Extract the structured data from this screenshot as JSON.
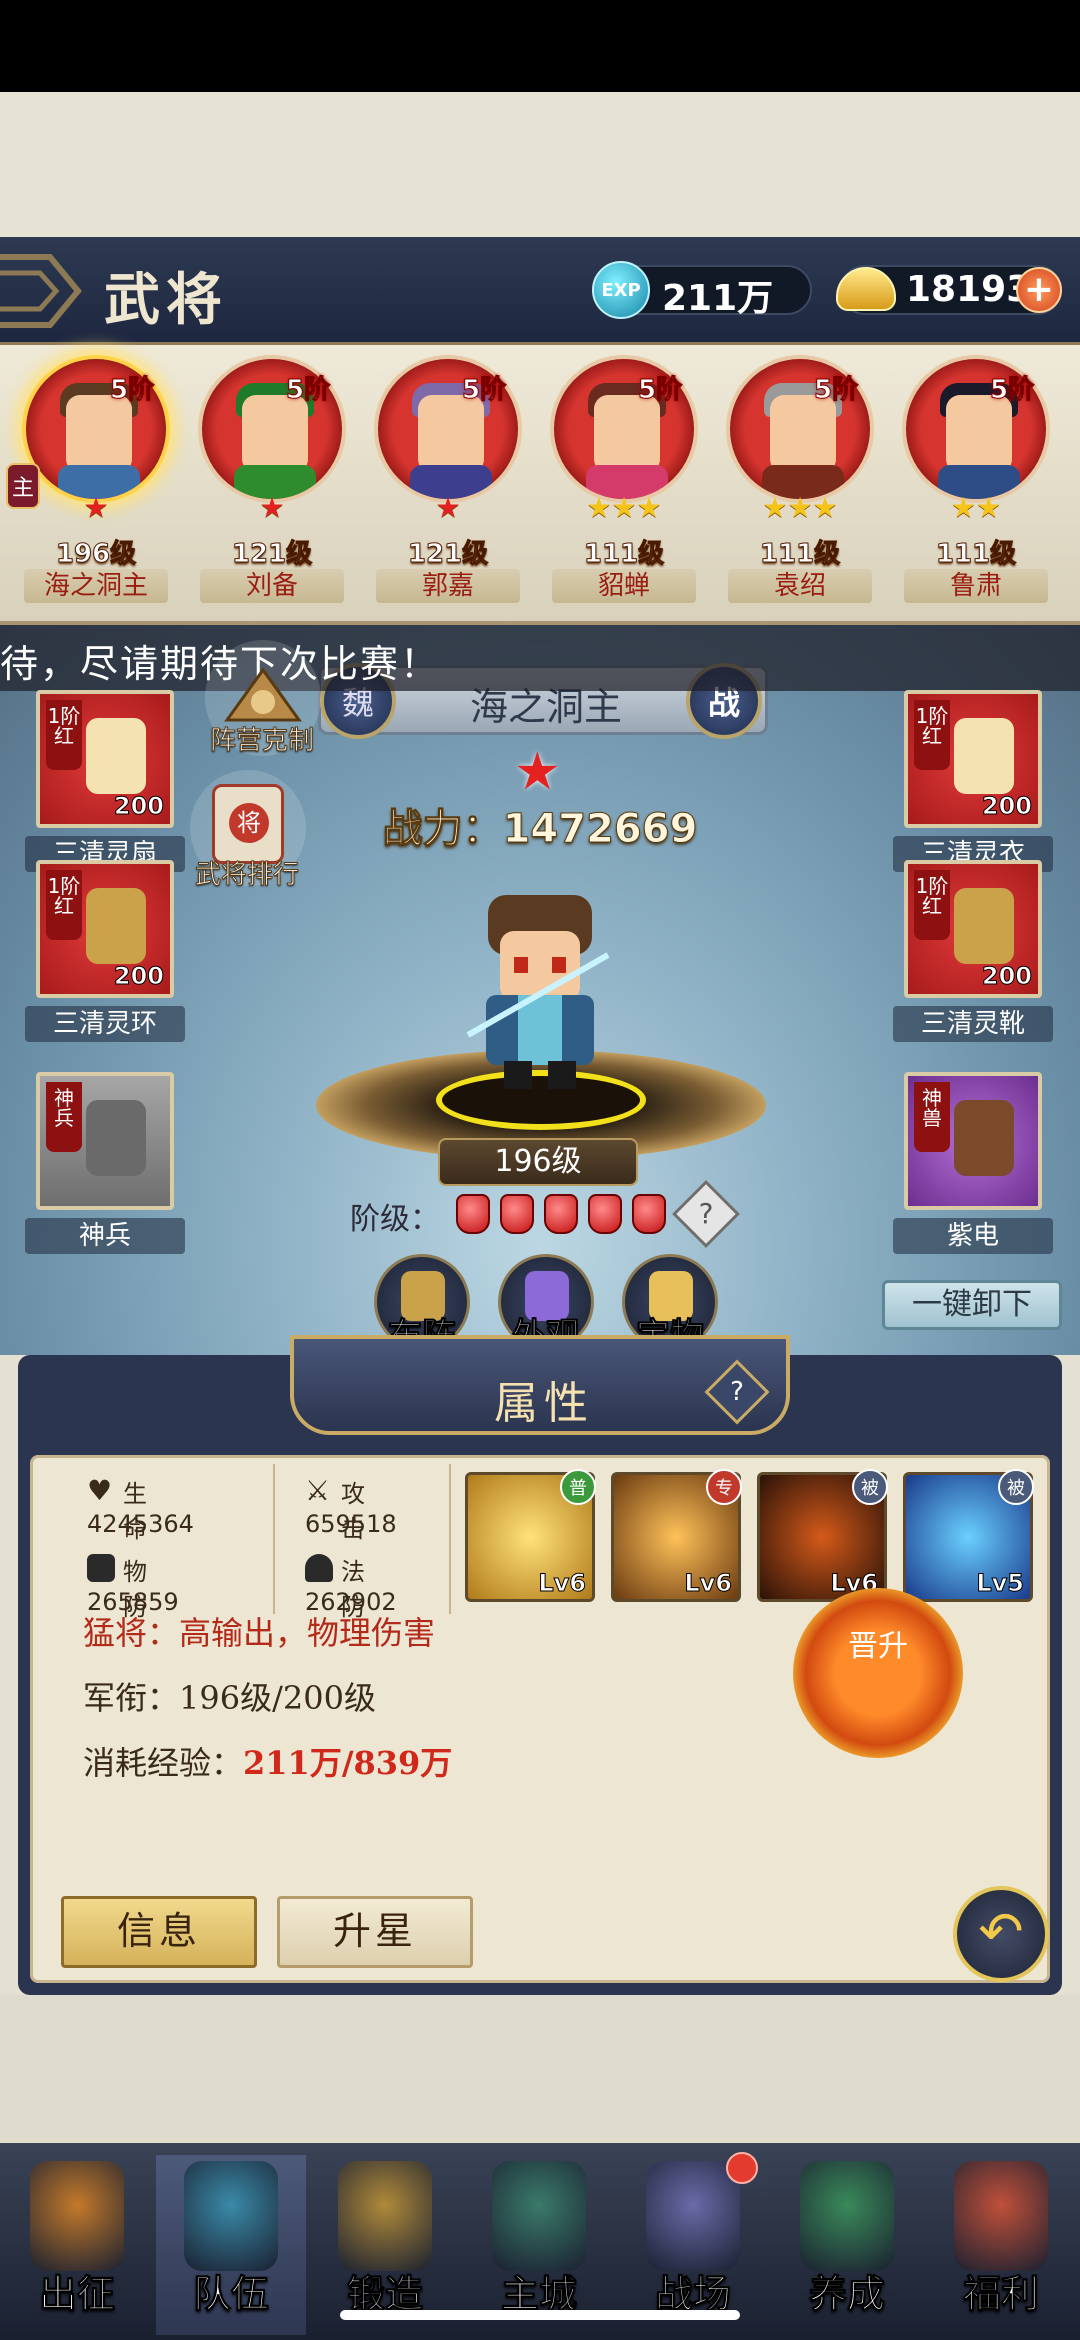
{
  "header": {
    "title": "武将",
    "exp_badge": "EXP",
    "exp_value": "211万",
    "gold_value": "18193",
    "gold_plus": "+"
  },
  "roster": {
    "main_badge": "主",
    "heroes": [
      {
        "name": "海之洞主",
        "level": "196级",
        "rank": "5阶",
        "stars": "★",
        "star_color": "red",
        "selected": true,
        "hair": "#5a3a20",
        "body": "#3e6ea6"
      },
      {
        "name": "刘备",
        "level": "121级",
        "rank": "5阶",
        "stars": "★",
        "star_color": "red",
        "hair": "#1f7a2a",
        "body": "#2e8c2e"
      },
      {
        "name": "郭嘉",
        "level": "121级",
        "rank": "5阶",
        "stars": "★",
        "star_color": "red",
        "hair": "#7e6aa8",
        "body": "#3e3e8e"
      },
      {
        "name": "貂蝉",
        "level": "111级",
        "rank": "5阶",
        "stars": "★★★",
        "star_color": "gold",
        "hair": "#6a2a20",
        "body": "#d43a6a"
      },
      {
        "name": "袁绍",
        "level": "111级",
        "rank": "5阶",
        "stars": "★★★",
        "star_color": "gold",
        "hair": "#9a9a9a",
        "body": "#7a2a1a"
      },
      {
        "name": "鲁肃",
        "level": "111级",
        "rank": "5阶",
        "stars": "★★",
        "star_color": "gold",
        "hair": "#1a1a2a",
        "body": "#2e4c86"
      }
    ]
  },
  "marquee": "待，尽请期待下次比赛！",
  "hero_detail": {
    "name": "海之洞主",
    "left_badge": "魏",
    "right_badge": "战",
    "star": "★",
    "power_label": "战力：",
    "power_value": "1472669",
    "level": "196级",
    "grade_label": "阶级：",
    "grade_gems": 5,
    "grade_help": "?"
  },
  "equipment": {
    "left": [
      {
        "label": "三清灵扇",
        "tier": "1阶红",
        "level": "200"
      },
      {
        "label": "三清灵环",
        "tier": "1阶红",
        "level": "200"
      },
      {
        "label": "神兵",
        "tier": "神兵",
        "level": ""
      }
    ],
    "right": [
      {
        "label": "三清灵衣",
        "tier": "1阶红",
        "level": "200"
      },
      {
        "label": "三清灵靴",
        "tier": "1阶红",
        "level": "200"
      },
      {
        "label": "紫电",
        "tier": "神兽",
        "level": ""
      }
    ]
  },
  "side_buttons": {
    "formation_counter": "阵营克制",
    "hero_ranking": "武将排行",
    "rank_badge": "将"
  },
  "action_buttons": [
    "布阵",
    "外观",
    "宝物"
  ],
  "unequip_all": "一键卸下",
  "attributes": {
    "title": "属性",
    "help": "?",
    "stats": [
      {
        "label": "生命",
        "value": "4245364"
      },
      {
        "label": "攻击",
        "value": "659518"
      },
      {
        "label": "物防",
        "value": "265859"
      },
      {
        "label": "法防",
        "value": "262902"
      }
    ],
    "skills": [
      {
        "tag": "普",
        "level": "Lv6",
        "tag_color": "#3c9a3c"
      },
      {
        "tag": "专",
        "level": "Lv6",
        "tag_color": "#c0392b"
      },
      {
        "tag": "被",
        "level": "Lv6",
        "tag_color": "#4a5a7a"
      },
      {
        "tag": "被",
        "level": "Lv5",
        "tag_color": "#4a5a7a"
      }
    ],
    "description": "猛将：高输出，物理伤害",
    "rank_text": "军衔：196级/200级",
    "exp_label": "消耗经验：",
    "exp_value": "211万/839万",
    "promote_label": "晋升",
    "info_button": "信息",
    "star_button": "升星",
    "back_icon": "↶"
  },
  "bottom_nav": [
    {
      "label": "出征",
      "icon": "expedition-icon",
      "color": "#c47a2a"
    },
    {
      "label": "队伍",
      "icon": "team-icon",
      "color": "#3a8aa8",
      "active": true
    },
    {
      "label": "锻造",
      "icon": "forge-icon",
      "color": "#b08a3a"
    },
    {
      "label": "主城",
      "icon": "city-icon",
      "color": "#3a7a6a"
    },
    {
      "label": "战场",
      "icon": "battlefield-icon",
      "color": "#6a6aa8",
      "badge": true
    },
    {
      "label": "养成",
      "icon": "cultivate-icon",
      "color": "#3a8a5a"
    },
    {
      "label": "福利",
      "icon": "welfare-icon",
      "color": "#c0503a"
    }
  ],
  "colors": {
    "header_bg": "#2d3a52",
    "accent_gold": "#c9ab66",
    "red_text": "#b42a1a",
    "nav_badge": "#e33b2e"
  }
}
